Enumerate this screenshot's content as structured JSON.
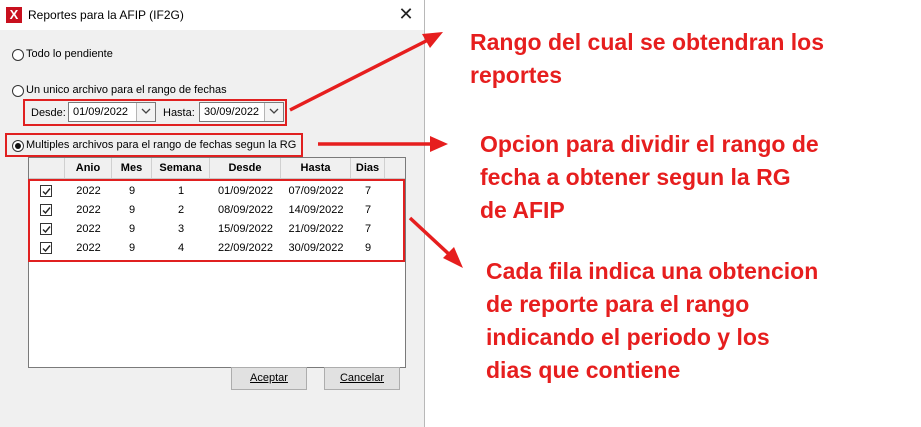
{
  "window": {
    "title": "Reportes para la AFIP (IF2G)",
    "icon_text": "X",
    "close_glyph": "✕"
  },
  "options": {
    "todo": "Todo lo pendiente",
    "unico": "Un unico archivo para el rango de fechas",
    "multiples": "Multiples archivos para el rango de fechas segun la RG",
    "selected": "multiples"
  },
  "range": {
    "desde_label": "Desde:",
    "desde_value": "01/09/2022",
    "hasta_label": "Hasta:",
    "hasta_value": "30/09/2022"
  },
  "table": {
    "columns": [
      "Anio",
      "Mes",
      "Semana",
      "Desde",
      "Hasta",
      "Dias"
    ],
    "rows": [
      {
        "checked": true,
        "anio": "2022",
        "mes": "9",
        "semana": "1",
        "desde": "01/09/2022",
        "hasta": "07/09/2022",
        "dias": "7"
      },
      {
        "checked": true,
        "anio": "2022",
        "mes": "9",
        "semana": "2",
        "desde": "08/09/2022",
        "hasta": "14/09/2022",
        "dias": "7"
      },
      {
        "checked": true,
        "anio": "2022",
        "mes": "9",
        "semana": "3",
        "desde": "15/09/2022",
        "hasta": "21/09/2022",
        "dias": "7"
      },
      {
        "checked": true,
        "anio": "2022",
        "mes": "9",
        "semana": "4",
        "desde": "22/09/2022",
        "hasta": "30/09/2022",
        "dias": "9"
      }
    ]
  },
  "buttons": {
    "aceptar": "Aceptar",
    "cancelar": "Cancelar"
  },
  "annotations": {
    "rango": [
      "Rango del cual se obtendran los",
      "reportes"
    ],
    "opcion": [
      "Opcion para dividir el rango de",
      "fecha a obtener segun la RG",
      "de AFIP"
    ],
    "fila": [
      "Cada fila indica una obtencion",
      "de reporte para el rango",
      "indicando el periodo y los",
      "dias que contiene"
    ]
  },
  "colors": {
    "annotation_red": "#e61e1e",
    "app_icon_red": "#c8101e",
    "dialog_bg": "#f0f0f0"
  }
}
